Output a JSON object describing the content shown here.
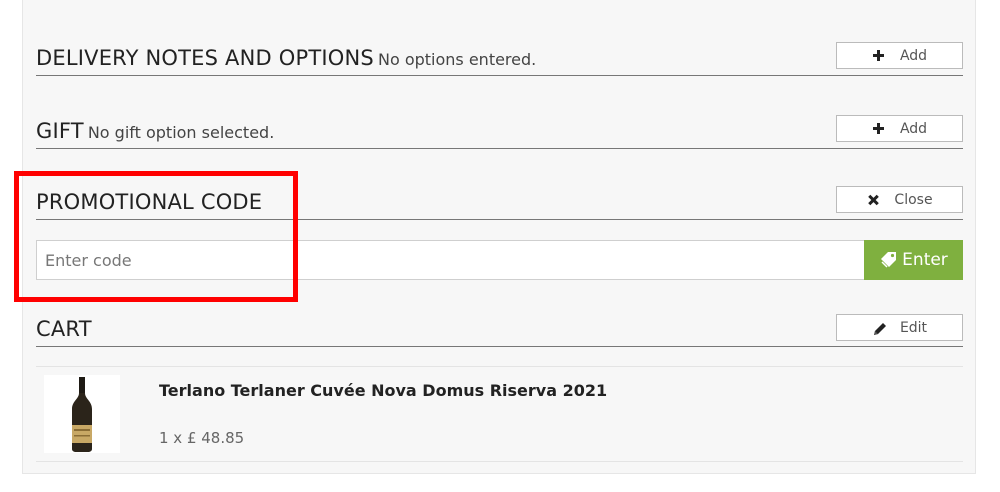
{
  "delivery": {
    "title": "DELIVERY NOTES AND OPTIONS",
    "status": "No options entered.",
    "button_label": "Add",
    "button_icon": "plus-icon"
  },
  "gift": {
    "title": "GIFT",
    "status": "No gift option selected.",
    "button_label": "Add",
    "button_icon": "plus-icon"
  },
  "promo": {
    "title": "PROMOTIONAL CODE",
    "button_label": "Close",
    "button_icon": "close-icon",
    "input_value": "",
    "input_placeholder": "Enter code",
    "submit_label": "Enter",
    "submit_icon": "tag-icon"
  },
  "cart": {
    "title": "CART",
    "button_label": "Edit",
    "button_icon": "pencil-icon",
    "items": [
      {
        "name": "Terlano Terlaner Cuvée Nova Domus Riserva 2021",
        "price_line": "1 x £ 48.85",
        "image": "wine-bottle"
      }
    ]
  },
  "colors": {
    "accent_green": "#7fb03f",
    "highlight_red": "#ff0000"
  }
}
